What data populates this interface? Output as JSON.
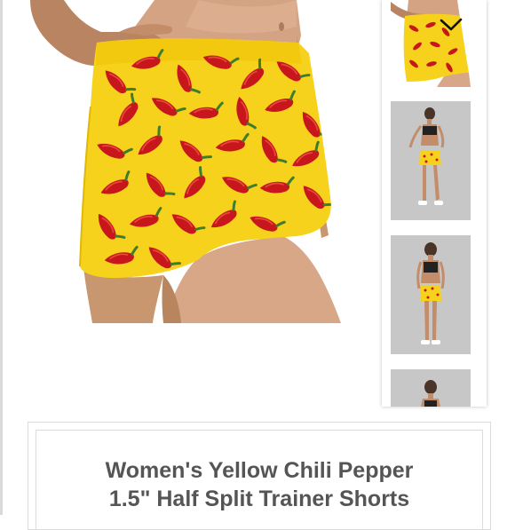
{
  "product": {
    "title_line1": "Women's Yellow Chili Pepper",
    "title_line2": "1.5\" Half Split Trainer Shorts"
  },
  "gallery": {
    "selected_index": 0,
    "thumbnails": [
      "shorts-closeup",
      "model-front",
      "model-standing",
      "model-partial"
    ],
    "icons": {
      "selected": "checkmark-icon"
    }
  },
  "colors": {
    "shorts_yellow": "#f7d21c",
    "pepper_red": "#c8161d",
    "stem_green": "#3f7d2c",
    "text_gray": "#555555"
  }
}
